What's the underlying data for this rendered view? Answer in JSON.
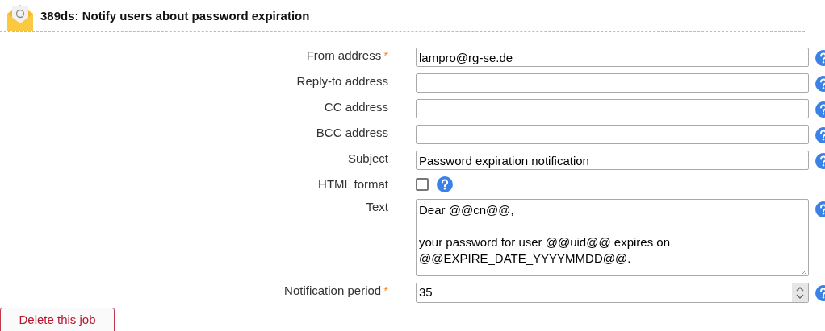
{
  "header": {
    "title": "389ds: Notify users about password expiration"
  },
  "fields": [
    {
      "kind": "text",
      "label": "From address",
      "required": true,
      "value": "lampro@rg-se.de"
    },
    {
      "kind": "text",
      "label": "Reply-to address",
      "required": false
    },
    {
      "kind": "text",
      "label": "CC address",
      "required": false
    },
    {
      "kind": "text",
      "label": "BCC address",
      "required": false
    },
    {
      "kind": "text",
      "label": "Subject",
      "required": false,
      "value": "Password expiration notification"
    },
    {
      "kind": "checkbox",
      "label": "HTML format",
      "required": false,
      "checked": false
    },
    {
      "kind": "textarea",
      "label": "Text",
      "required": false,
      "value": "Dear @@cn@@,\n\nyour password for user @@uid@@ expires on\n@@EXPIRE_DATE_YYYYMMDD@@."
    },
    {
      "kind": "number",
      "label": "Notification period",
      "required": true,
      "value": "35"
    }
  ],
  "required_marker": "*",
  "delete_button": "Delete this job"
}
